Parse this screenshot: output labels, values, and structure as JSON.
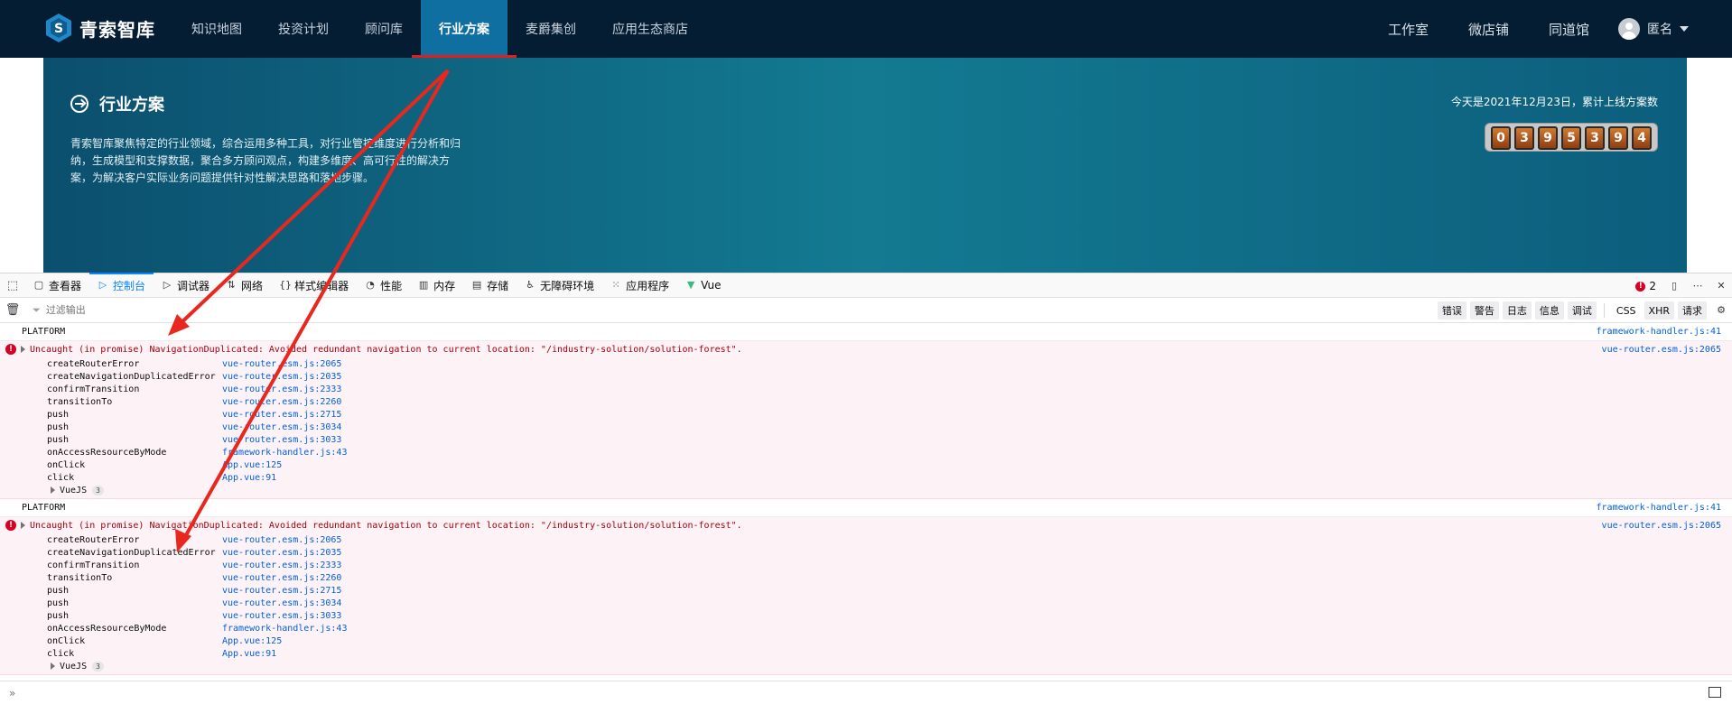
{
  "app": {
    "logo_text": "青索智库",
    "nav": [
      {
        "label": "知识地图",
        "active": false
      },
      {
        "label": "投资计划",
        "active": false
      },
      {
        "label": "顾问库",
        "active": false
      },
      {
        "label": "行业方案",
        "active": true
      },
      {
        "label": "麦爵集创",
        "active": false
      },
      {
        "label": "应用生态商店",
        "active": false
      }
    ],
    "nav_right": [
      "工作室",
      "微店铺",
      "同道馆"
    ],
    "user_name": "匿名"
  },
  "banner": {
    "title": "行业方案",
    "description": "青索智库聚焦特定的行业领域，综合运用多种工具，对行业管控维度进行分析和归纳，生成模型和支撑数据，聚合多方顾问观点，构建多维度、高可行性的解决方案，为解决客户实际业务问题提供针对性解决思路和落地步骤。",
    "date_text": "今天是2021年12月23日，累计上线方案数",
    "counter_digits": [
      "0",
      "3",
      "9",
      "5",
      "3",
      "9",
      "4"
    ]
  },
  "devtools": {
    "tabs": [
      {
        "label": "查看器",
        "icon": "inspector-icon"
      },
      {
        "label": "控制台",
        "icon": "console-icon",
        "active": true
      },
      {
        "label": "调试器",
        "icon": "debugger-icon"
      },
      {
        "label": "网络",
        "icon": "network-icon"
      },
      {
        "label": "样式编辑器",
        "icon": "style-editor-icon"
      },
      {
        "label": "性能",
        "icon": "performance-icon"
      },
      {
        "label": "内存",
        "icon": "memory-icon"
      },
      {
        "label": "存储",
        "icon": "storage-icon"
      },
      {
        "label": "无障碍环境",
        "icon": "accessibility-icon"
      },
      {
        "label": "应用程序",
        "icon": "application-icon"
      },
      {
        "label": "Vue",
        "icon": "vue-icon"
      }
    ],
    "error_count": "2",
    "filter_placeholder": "过滤输出",
    "levels": [
      "错误",
      "警告",
      "日志",
      "信息",
      "调试"
    ],
    "types": [
      "CSS",
      "XHR",
      "请求"
    ],
    "prompt": "»"
  },
  "console": {
    "groups": [
      {
        "log_text": "PLATFORM",
        "log_loc": "framework-handler.js:41",
        "error": {
          "message": "Uncaught (in promise) NavigationDuplicated: Avoided redundant navigation to current location: \"/industry-solution/solution-forest\".",
          "loc": "vue-router.esm.js:2065",
          "frames": [
            {
              "fn": "createRouterError",
              "src": "vue-router.esm.js:2065"
            },
            {
              "fn": "createNavigationDuplicatedError",
              "src": "vue-router.esm.js:2035"
            },
            {
              "fn": "confirmTransition",
              "src": "vue-router.esm.js:2333"
            },
            {
              "fn": "transitionTo",
              "src": "vue-router.esm.js:2260"
            },
            {
              "fn": "push",
              "src": "vue-router.esm.js:2715"
            },
            {
              "fn": "push",
              "src": "vue-router.esm.js:3034"
            },
            {
              "fn": "push",
              "src": "vue-router.esm.js:3033"
            },
            {
              "fn": "onAccessResourceByMode",
              "src": "framework-handler.js:43"
            },
            {
              "fn": "onClick",
              "src": "App.vue:125"
            },
            {
              "fn": "click",
              "src": "App.vue:91"
            }
          ],
          "vue_label": "VueJS",
          "vue_count": "3"
        }
      },
      {
        "log_text": "PLATFORM",
        "log_loc": "framework-handler.js:41",
        "error": {
          "message": "Uncaught (in promise) NavigationDuplicated: Avoided redundant navigation to current location: \"/industry-solution/solution-forest\".",
          "loc": "vue-router.esm.js:2065",
          "frames": [
            {
              "fn": "createRouterError",
              "src": "vue-router.esm.js:2065"
            },
            {
              "fn": "createNavigationDuplicatedError",
              "src": "vue-router.esm.js:2035"
            },
            {
              "fn": "confirmTransition",
              "src": "vue-router.esm.js:2333"
            },
            {
              "fn": "transitionTo",
              "src": "vue-router.esm.js:2260"
            },
            {
              "fn": "push",
              "src": "vue-router.esm.js:2715"
            },
            {
              "fn": "push",
              "src": "vue-router.esm.js:3034"
            },
            {
              "fn": "push",
              "src": "vue-router.esm.js:3033"
            },
            {
              "fn": "onAccessResourceByMode",
              "src": "framework-handler.js:43"
            },
            {
              "fn": "onClick",
              "src": "App.vue:125"
            },
            {
              "fn": "click",
              "src": "App.vue:91"
            }
          ],
          "vue_label": "VueJS",
          "vue_count": "3"
        }
      }
    ]
  },
  "colors": {
    "nav_bg": "#041d33",
    "nav_active": "#0e6fa0",
    "underline": "#e21d1d",
    "banner": "#137a92",
    "error_bg": "#fdf2f5",
    "error_text": "#a4000f",
    "link": "#0060df",
    "annotation_arrow": "#e8281e"
  }
}
